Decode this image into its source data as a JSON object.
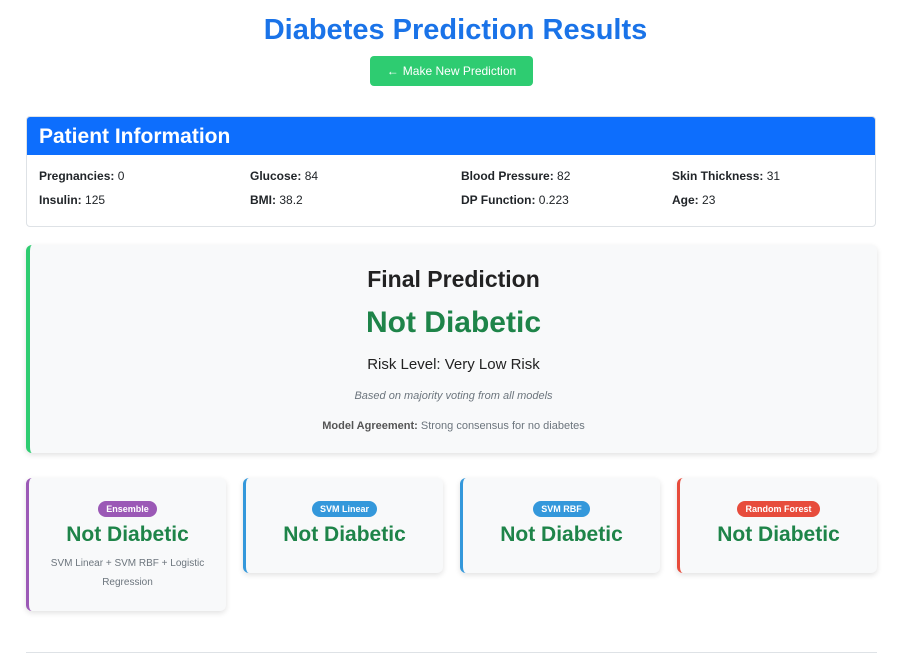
{
  "page": {
    "title": "Diabetes Prediction Results"
  },
  "actions": {
    "new_prediction_arrow": "←",
    "new_prediction_label": "Make New Prediction",
    "button_color": "#2ecc71"
  },
  "patient": {
    "header": "Patient Information",
    "fields": [
      {
        "label": "Pregnancies:",
        "value": "0"
      },
      {
        "label": "Glucose:",
        "value": "84"
      },
      {
        "label": "Blood Pressure:",
        "value": "82"
      },
      {
        "label": "Skin Thickness:",
        "value": "31"
      },
      {
        "label": "Insulin:",
        "value": "125"
      },
      {
        "label": "BMI:",
        "value": "38.2"
      },
      {
        "label": "DP Function:",
        "value": "0.223"
      },
      {
        "label": "Age:",
        "value": "23"
      }
    ]
  },
  "final": {
    "title": "Final Prediction",
    "verdict": "Not Diabetic",
    "risk_label": "Risk Level:",
    "risk_value": "Very Low Risk",
    "voting_note": "Based on majority voting from all models",
    "agreement_label": "Model Agreement:",
    "agreement_value": "Strong consensus for no diabetes",
    "accent": "#2ecc71"
  },
  "models": [
    {
      "badge": "Ensemble",
      "color": "#9b59b6",
      "verdict": "Not Diabetic",
      "description": "SVM Linear + SVM RBF + Logistic Regression"
    },
    {
      "badge": "SVM Linear",
      "color": "#3498db",
      "verdict": "Not Diabetic"
    },
    {
      "badge": "SVM RBF",
      "color": "#3498db",
      "verdict": "Not Diabetic"
    },
    {
      "badge": "Random Forest",
      "color": "#e74c3c",
      "verdict": "Not Diabetic"
    }
  ],
  "colors": {
    "title": "#1a73e8",
    "header": "#0d6efd",
    "success_text": "#1e8449"
  }
}
